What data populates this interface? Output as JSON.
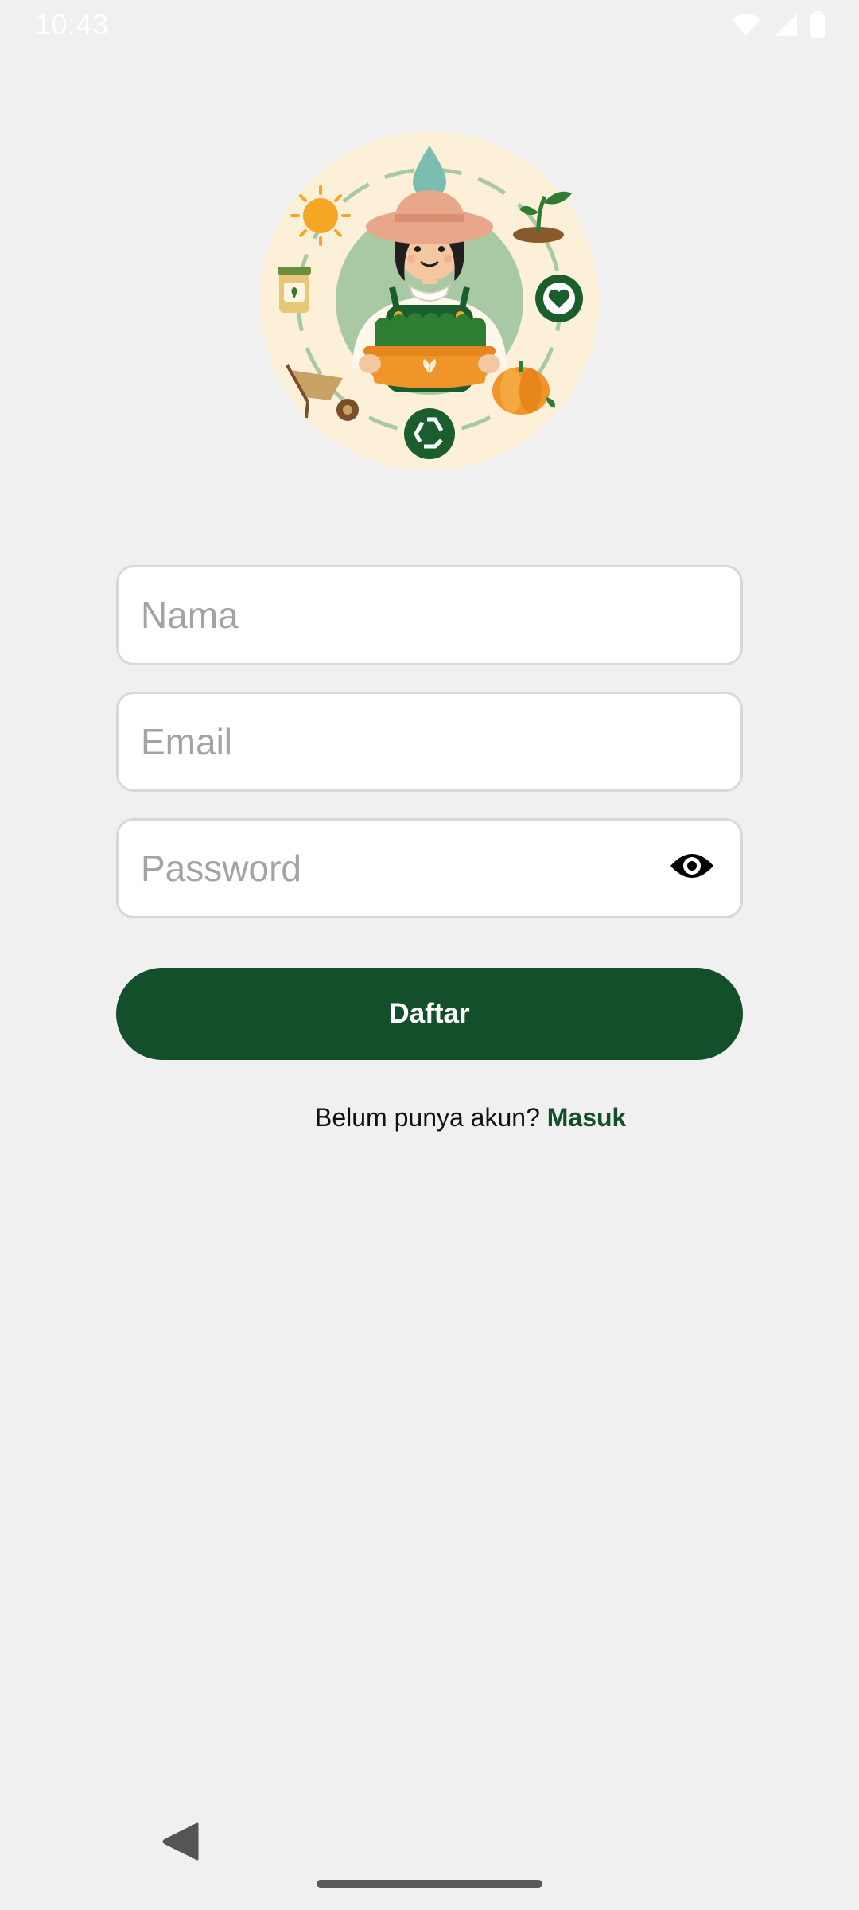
{
  "status_bar": {
    "time": "10:43",
    "icons": [
      "wifi-icon",
      "signal-icon",
      "battery-icon"
    ]
  },
  "illustration": {
    "description_icon": "farmer-illustration",
    "colors": {
      "background": "#fdf0d8",
      "inner_circle": "#a9c9a4",
      "green": "#1b5e2e",
      "orange": "#f0952a"
    }
  },
  "form": {
    "name": {
      "placeholder": "Nama",
      "value": ""
    },
    "email": {
      "placeholder": "Email",
      "value": ""
    },
    "password": {
      "placeholder": "Password",
      "value": "",
      "toggle_icon": "eye-icon"
    }
  },
  "register_button": {
    "label": "Daftar"
  },
  "login_prompt": {
    "text": "Belum punya akun? ",
    "link_label": "Masuk"
  },
  "nav_bar": {
    "back_icon": "back-triangle-icon",
    "home_icon": "home-pill"
  },
  "colors": {
    "primary": "#134f2a",
    "background": "#f0f0f0",
    "field_border": "#d8d8d8",
    "placeholder": "#a3a3a3"
  }
}
